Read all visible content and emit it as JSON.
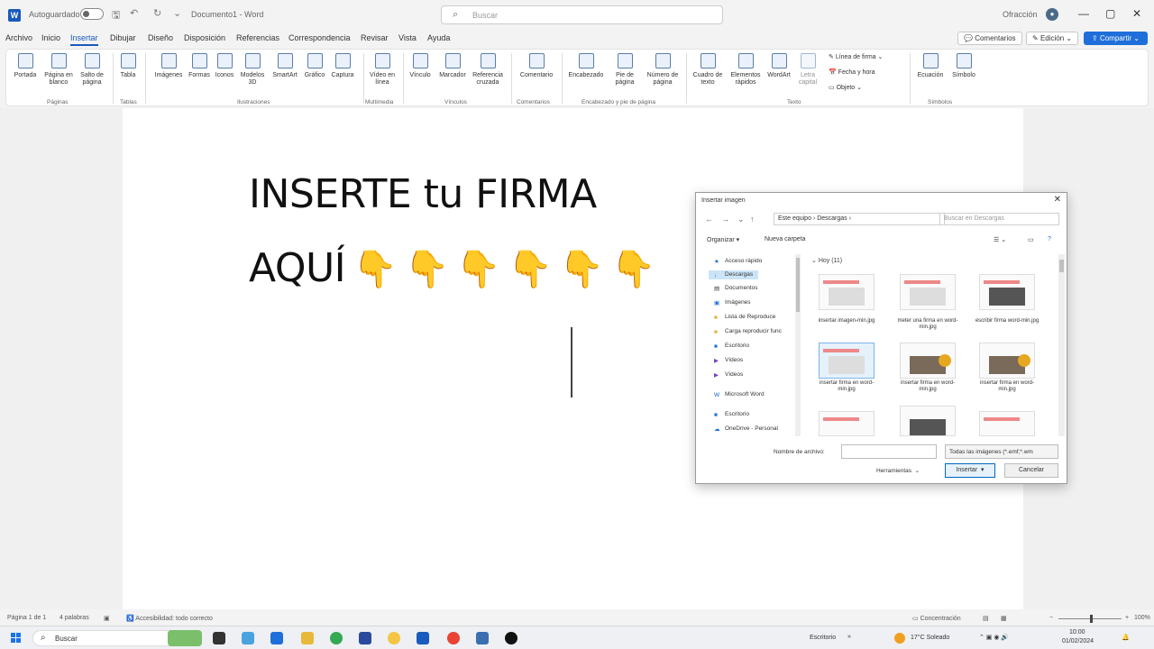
{
  "titlebar": {
    "autosave_label": "Autoguardado",
    "doc_title": "Documento1 - Word",
    "search_placeholder": "Buscar",
    "user_name": "Ofracción"
  },
  "menu": {
    "tabs": [
      "Archivo",
      "Inicio",
      "Insertar",
      "Dibujar",
      "Diseño",
      "Disposición",
      "Referencias",
      "Correspondencia",
      "Revisar",
      "Vista",
      "Ayuda"
    ],
    "active_tab": "Insertar",
    "comments_label": "Comentarios",
    "editing_label": "Edición",
    "share_label": "Compartir"
  },
  "ribbon": {
    "buttons": [
      {
        "label": "Portada"
      },
      {
        "label": "Página en blanco"
      },
      {
        "label": "Salto de página"
      },
      {
        "label": "Tabla"
      },
      {
        "label": "Imágenes"
      },
      {
        "label": "Formas"
      },
      {
        "label": "Iconos"
      },
      {
        "label": "Modelos 3D"
      },
      {
        "label": "SmartArt"
      },
      {
        "label": "Gráfico"
      },
      {
        "label": "Captura"
      },
      {
        "label": "Vídeo en línea"
      },
      {
        "label": "Vínculo"
      },
      {
        "label": "Marcador"
      },
      {
        "label": "Referencia cruzada"
      },
      {
        "label": "Comentario"
      },
      {
        "label": "Encabezado"
      },
      {
        "label": "Pie de página"
      },
      {
        "label": "Número de página"
      },
      {
        "label": "Cuadro de texto"
      },
      {
        "label": "Elementos rápidos"
      },
      {
        "label": "WordArt"
      },
      {
        "label": "Letra capital"
      },
      {
        "label": "Ecuación"
      },
      {
        "label": "Símbolo"
      }
    ],
    "small_buttons": [
      "Línea de firma",
      "Fecha y hora",
      "Objeto"
    ],
    "groups": [
      "Páginas",
      "Tablas",
      "Ilustraciones",
      "Multimedia",
      "Vínculos",
      "Comentarios",
      "Encabezado y pie de página",
      "Texto",
      "Símbolos"
    ]
  },
  "document": {
    "line1": "INSERTE tu FIRMA",
    "line2": "AQUÍ",
    "emoji": "👇"
  },
  "dialog": {
    "title": "Insertar imagen",
    "path": "Este equipo  ›  Descargas  ›",
    "search_placeholder": "Buscar en Descargas",
    "organize_label": "Organizar ▾",
    "new_folder_label": "Nueva carpeta",
    "nav_items": [
      "Acceso rápido",
      "Descargas",
      "Documentos",
      "Imágenes",
      "Lista de Reproduce",
      "Carga reproducir func",
      "Escritorio",
      "Vídeos",
      "Vídeos",
      "Microsoft Word",
      "Escritorio",
      "OneDrive - Personal"
    ],
    "group_header": "Hoy (11)",
    "files": [
      {
        "name": "insertar imagen-min.jpg"
      },
      {
        "name": "meter una firma en word-min.jpg"
      },
      {
        "name": "escribir firma word-min.jpg"
      },
      {
        "name": "insertar firma en word-min.jpg"
      },
      {
        "name": "insertar firma en word-min.jpg"
      },
      {
        "name": "insertar firma en word-min.jpg"
      }
    ],
    "filename_label": "Nombre de archivo:",
    "filename_value": "",
    "filter_value": "Todas las imágenes (*.emf;*.wm",
    "tools_label": "Herramientas",
    "insert_label": "Insertar",
    "cancel_label": "Cancelar"
  },
  "statusbar": {
    "page": "Página 1 de 1",
    "words": "4 palabras",
    "accessibility": "Accesibilidad: todo correcto",
    "focus": "Concentración",
    "zoom": "100%"
  },
  "taskbar": {
    "search_placeholder": "Buscar",
    "desktop_label": "Escritorio",
    "weather": "17°C  Soleado",
    "time": "10:00",
    "date": "01/02/2024"
  }
}
